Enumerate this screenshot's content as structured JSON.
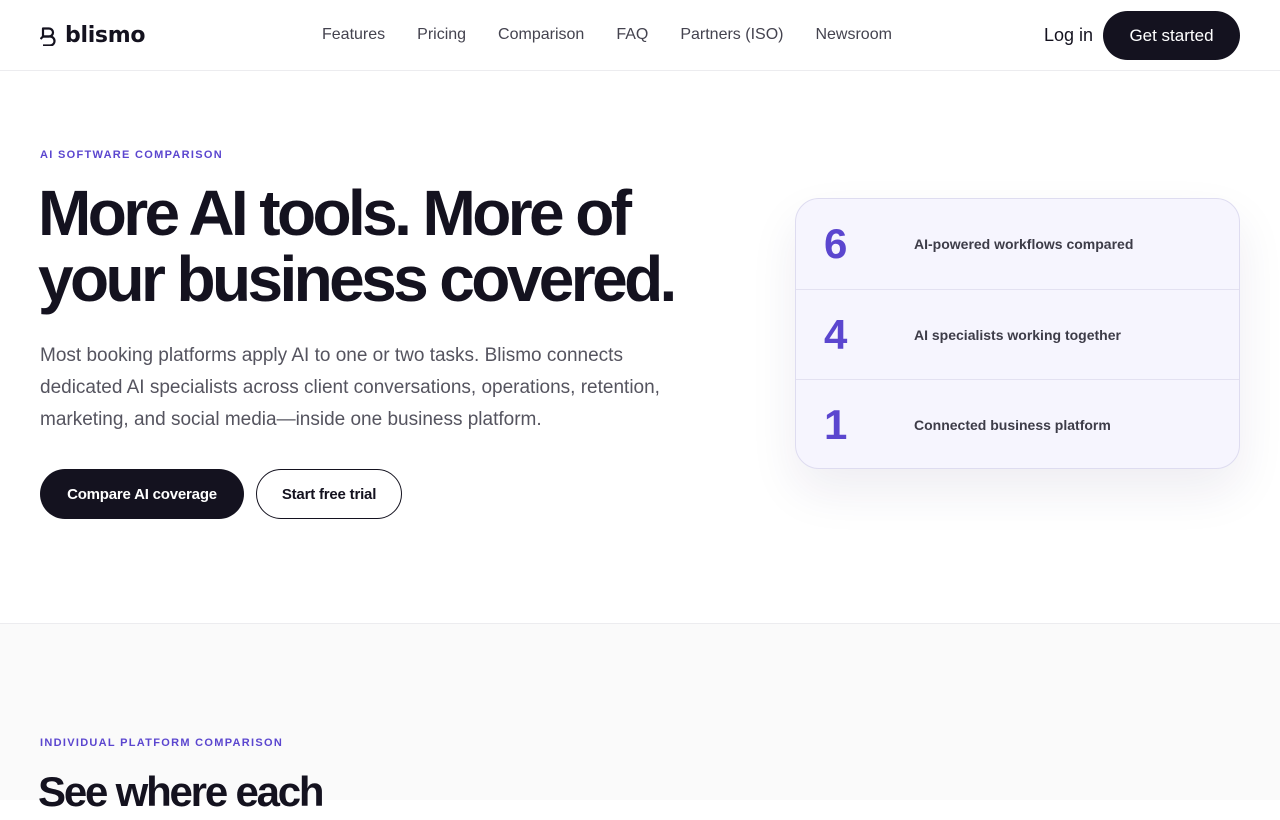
{
  "header": {
    "brand": "blismo",
    "nav": [
      "Features",
      "Pricing",
      "Comparison",
      "FAQ",
      "Partners (ISO)",
      "Newsroom"
    ],
    "login": "Log in",
    "cta": "Get started"
  },
  "hero": {
    "eyebrow": "AI SOFTWARE COMPARISON",
    "title_line1": "More AI tools. More of",
    "title_line2": "your business covered.",
    "subtitle": "Most booking platforms apply AI to one or two tasks. Blismo connects dedicated AI specialists across client conversations, operations, retention, marketing, and social media—inside one business platform.",
    "primary_cta": "Compare AI coverage",
    "secondary_cta": "Start free trial"
  },
  "stats": [
    {
      "value": "6",
      "label": "AI-powered workflows compared"
    },
    {
      "value": "4",
      "label": "AI specialists working together"
    },
    {
      "value": "1",
      "label": "Connected business platform"
    }
  ],
  "section2": {
    "eyebrow": "INDIVIDUAL PLATFORM COMPARISON",
    "title": "See where each"
  },
  "colors": {
    "accent": "#5b46cf",
    "dark": "#14121f",
    "card_bg": "#f6f5fe"
  }
}
